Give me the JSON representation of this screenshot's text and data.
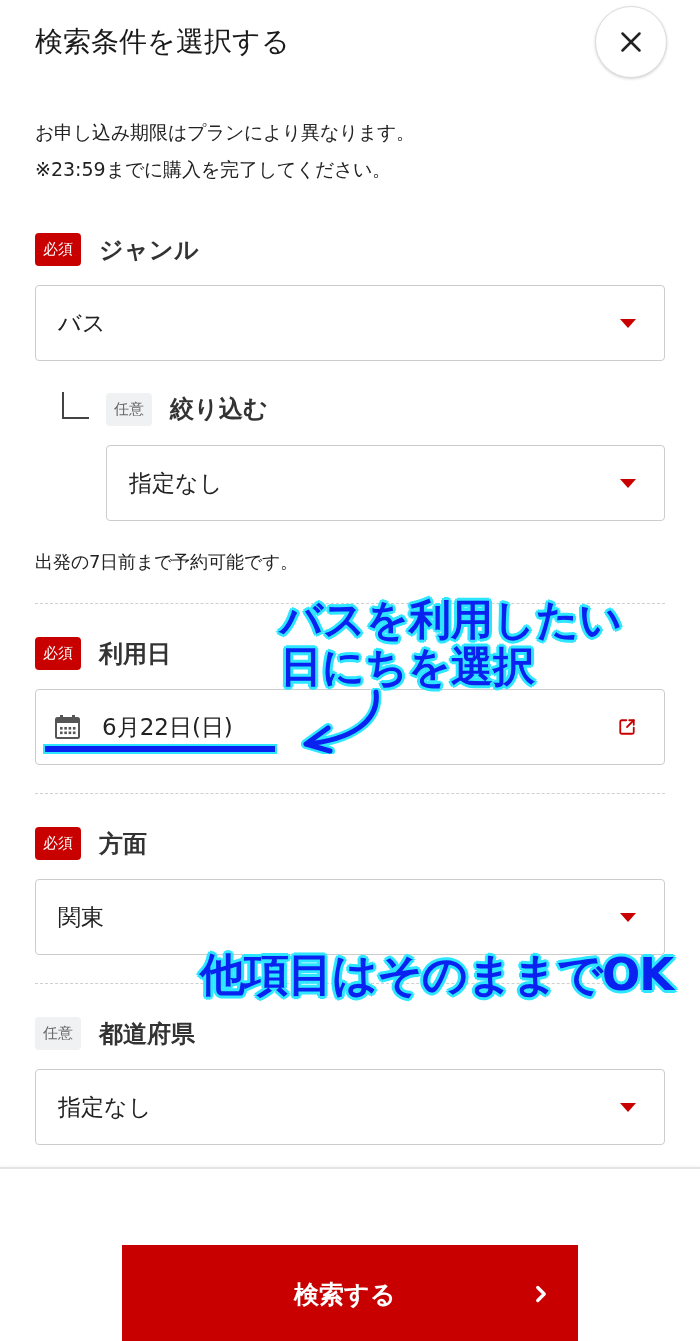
{
  "header": {
    "title": "検索条件を選択する"
  },
  "notice": [
    "お申し込み期限はプランにより異なります。",
    "※23:59までに購入を完了してください。"
  ],
  "fields": [
    {
      "kind": "select",
      "required": true,
      "badge": "必須",
      "label": "ジャンル",
      "value": "バス",
      "children": [
        {
          "kind": "select",
          "required": false,
          "badge": "任意",
          "label": "絞り込む",
          "value": "指定なし"
        }
      ],
      "note": "出発の7日前まで予約可能です。"
    },
    {
      "kind": "date",
      "required": true,
      "badge": "必須",
      "label": "利用日",
      "value": "6月22日(日)",
      "annotation": {
        "kind": "callout",
        "lines": [
          "バスを利用したい",
          "日にちを選択"
        ]
      }
    },
    {
      "kind": "select",
      "required": true,
      "badge": "必須",
      "label": "方面",
      "value": "関東",
      "annotation": {
        "kind": "note",
        "lines": [
          "他項目はそのままでOK"
        ]
      }
    },
    {
      "kind": "select",
      "required": false,
      "badge": "任意",
      "label": "都道府県",
      "value": "指定なし"
    }
  ],
  "search_button": {
    "label": "検索する"
  }
}
